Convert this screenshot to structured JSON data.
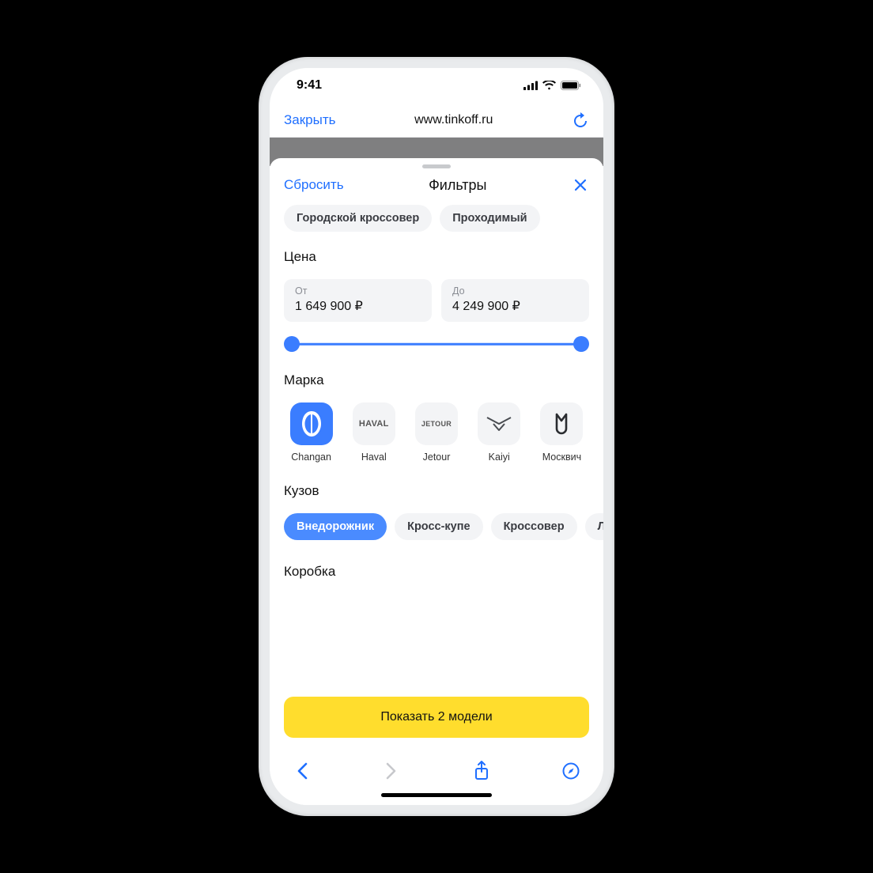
{
  "status": {
    "time": "9:41"
  },
  "browser": {
    "close_label": "Закрыть",
    "url": "www.tinkoff.ru"
  },
  "sheet": {
    "reset_label": "Сбросить",
    "title": "Фильтры",
    "top_chips": [
      "Городской кроссовер",
      "Проходимый"
    ]
  },
  "price": {
    "section_label": "Цена",
    "from_label": "От",
    "from_value": "1 649 900 ₽",
    "to_label": "До",
    "to_value": "4 249 900 ₽"
  },
  "brand": {
    "section_label": "Марка",
    "items": [
      {
        "name": "Changan",
        "selected": true
      },
      {
        "name": "Haval",
        "logo_text": "HAVAL"
      },
      {
        "name": "Jetour",
        "logo_text": "JETOUR"
      },
      {
        "name": "Kaiyi"
      },
      {
        "name": "Москвич"
      }
    ]
  },
  "body": {
    "section_label": "Кузов",
    "chips": [
      {
        "label": "Внедорожник",
        "selected": true
      },
      {
        "label": "Кросс-купе"
      },
      {
        "label": "Кроссовер"
      },
      {
        "label": "Л"
      }
    ]
  },
  "gearbox": {
    "section_label": "Коробка"
  },
  "cta": {
    "label": "Показать 2 модели"
  },
  "colors": {
    "accent_blue": "#1f6fff",
    "cta_yellow": "#ffdd2d"
  }
}
